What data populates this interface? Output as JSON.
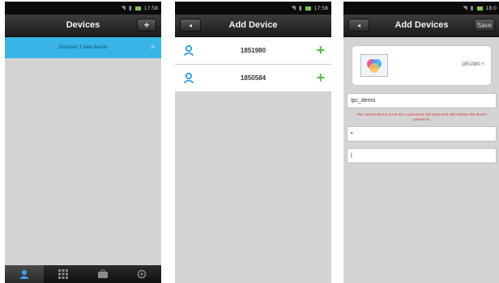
{
  "status_bar": {
    "p1_time": "17:58",
    "p2_time": "17:58",
    "p3_time": "18:0"
  },
  "panel1": {
    "title": "Devices",
    "add_label": "+",
    "discover_label": "Discover  1  new device",
    "discover_chevron": ">",
    "tabs": [
      {
        "icon": "person-icon",
        "active": true
      },
      {
        "icon": "grid-icon",
        "active": false
      },
      {
        "icon": "briefcase-icon",
        "active": false
      },
      {
        "icon": "settings-icon",
        "active": false
      }
    ]
  },
  "panel2": {
    "title": "Add Device",
    "back_label": "◂",
    "devices": [
      "1851980",
      "1850584"
    ],
    "add_symbol": "+"
  },
  "panel3": {
    "title": "Add Devices",
    "back_label": "◂",
    "save_label": "Save",
    "device_id": "1851980 ˅",
    "name_value": "ipc_demo",
    "warning": "The current device is not set a password, this password will initialize the device password.",
    "password_value": "•",
    "confirm_value": "|"
  },
  "colors": {
    "accent_blue": "#39b4e6",
    "add_green": "#56b948",
    "warning_red": "#d33333",
    "titlebar": "#2a2a2a"
  }
}
